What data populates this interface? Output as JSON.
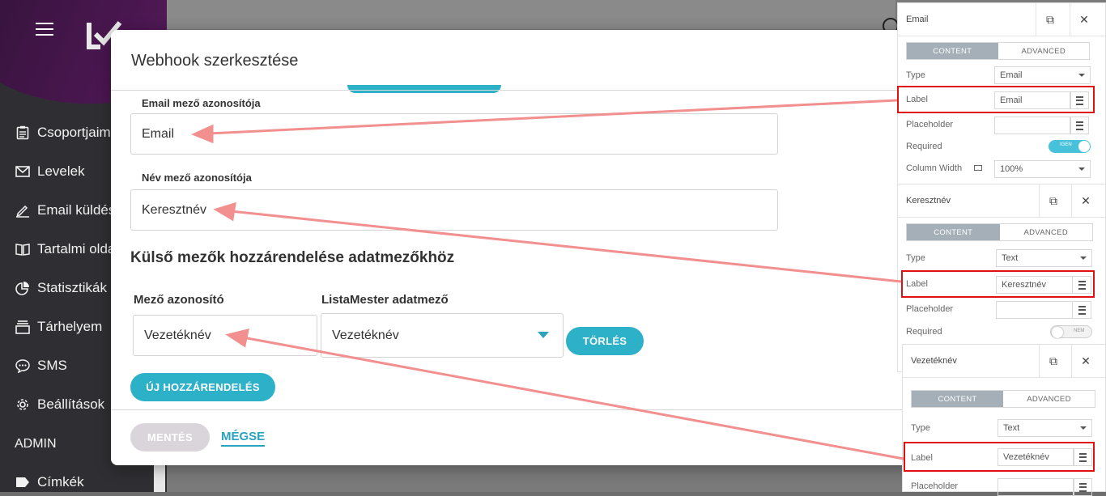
{
  "sidebar": {
    "items": [
      {
        "label": "Csoportjaim",
        "icon": "clipboard-icon"
      },
      {
        "label": "Levelek",
        "icon": "mail-icon"
      },
      {
        "label": "Email küldés",
        "icon": "pencil-icon"
      },
      {
        "label": "Tartalmi oldalak",
        "icon": "book-icon"
      },
      {
        "label": "Statisztikák",
        "icon": "pie-chart-icon"
      },
      {
        "label": "Tárhelyem",
        "icon": "storage-icon"
      },
      {
        "label": "SMS",
        "icon": "chat-icon"
      },
      {
        "label": "Beállítások",
        "icon": "gear-icon"
      }
    ],
    "admin_label": "ADMIN",
    "tags_label": "Címkék"
  },
  "dialog": {
    "title": "Webhook szerkesztése",
    "email_field_label": "Email mező azonosítója",
    "email_field_value": "Email",
    "name_field_label": "Név mező azonosítója",
    "name_field_value": "Keresztnév",
    "mapping_title": "Külső mezők hozzárendelése adatmezőkhöz",
    "col_field_id": "Mező azonosító",
    "col_list_field": "ListaMester adatmező",
    "mapping_row": {
      "field_id": "Vezetéknév",
      "list_field": "Vezetéknév"
    },
    "delete_button": "TÖRLÉS",
    "new_mapping_button": "ÚJ HOZZÁRENDELÉS",
    "save_button": "MENTÉS",
    "cancel_button": "MÉGSE"
  },
  "panels": [
    {
      "title": "Email",
      "tab_content": "CONTENT",
      "tab_advanced": "ADVANCED",
      "type_label": "Type",
      "type_value": "Email",
      "label_label": "Label",
      "label_value": "Email",
      "placeholder_label": "Placeholder",
      "required_label": "Required",
      "required_state": "IGEN",
      "column_width_label": "Column Width",
      "column_width_value": "100%"
    },
    {
      "title": "Keresztnév",
      "tab_content": "CONTENT",
      "tab_advanced": "ADVANCED",
      "type_label": "Type",
      "type_value": "Text",
      "label_label": "Label",
      "label_value": "Keresztnév",
      "placeholder_label": "Placeholder",
      "required_label": "Required",
      "required_state": "NEM"
    },
    {
      "title": "Vezetéknév",
      "tab_content": "CONTENT",
      "tab_advanced": "ADVANCED",
      "type_label": "Type",
      "type_value": "Text",
      "label_label": "Label",
      "label_value": "Vezetéknév",
      "placeholder_label": "Placeholder"
    }
  ],
  "colors": {
    "accent": "#2cb1c9",
    "highlight_box": "#e01010",
    "annotation_arrow": "#f28f8f",
    "disabled_button": "#d9d5da"
  }
}
